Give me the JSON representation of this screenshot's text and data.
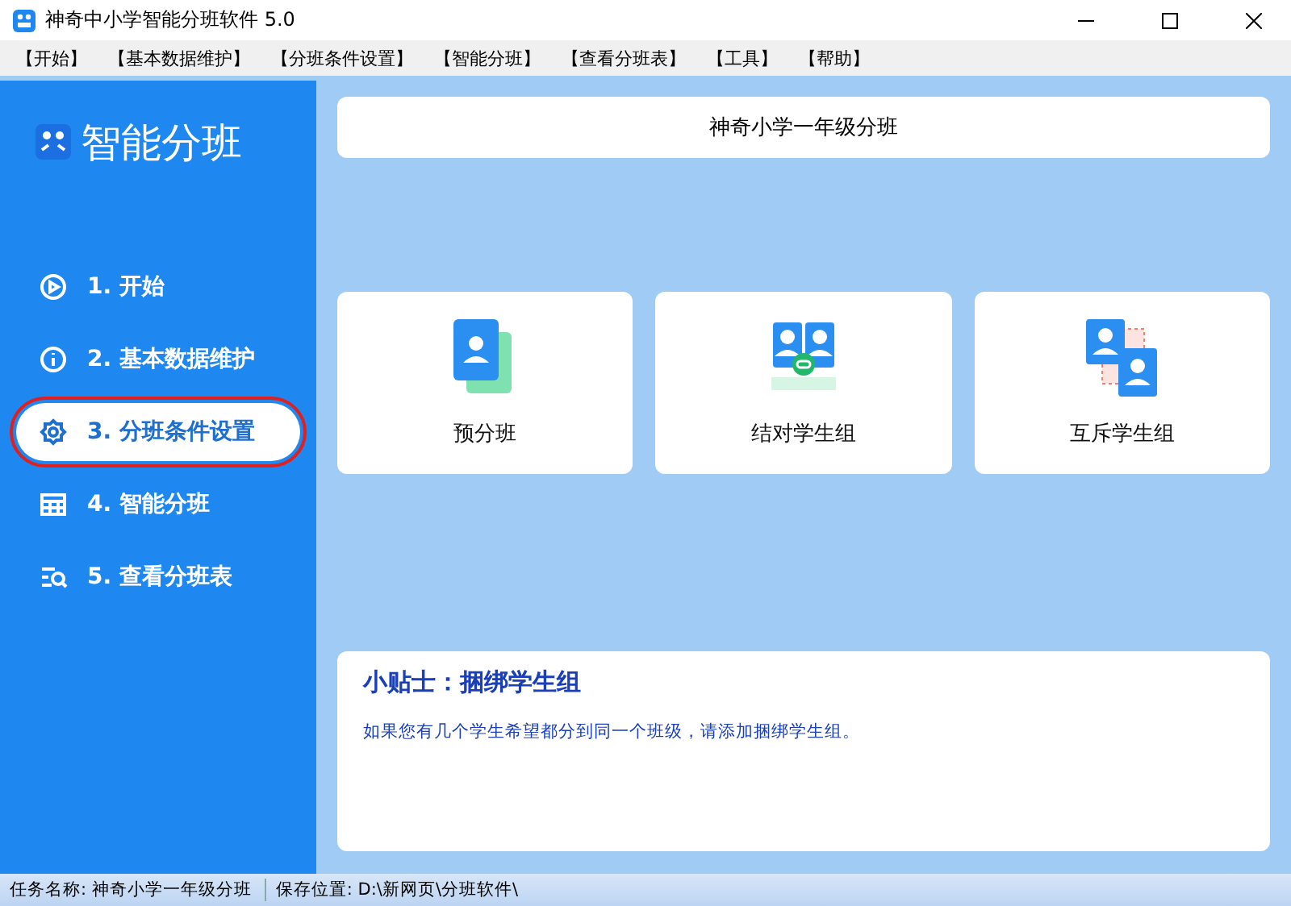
{
  "window": {
    "title": "神奇中小学智能分班软件 5.0"
  },
  "menu": [
    "【开始】",
    "【基本数据维护】",
    "【分班条件设置】",
    "【智能分班】",
    "【查看分班表】",
    "【工具】",
    "【帮助】"
  ],
  "sidebar": {
    "logo": "智能分班",
    "items": [
      {
        "label": "1. 开始",
        "selected": false
      },
      {
        "label": "2. 基本数据维护",
        "selected": false
      },
      {
        "label": "3. 分班条件设置",
        "selected": true
      },
      {
        "label": "4. 智能分班",
        "selected": false
      },
      {
        "label": "5. 查看分班表",
        "selected": false
      }
    ]
  },
  "header": "神奇小学一年级分班",
  "cards": [
    {
      "label": "预分班",
      "kind": "pre"
    },
    {
      "label": "结对学生组",
      "kind": "pair"
    },
    {
      "label": "互斥学生组",
      "kind": "exclusive"
    }
  ],
  "tip": {
    "title": "小贴士：捆绑学生组",
    "text": "如果您有几个学生希望都分到同一个班级，请添加捆绑学生组。"
  },
  "status_bar": [
    {
      "label": "任务名称:",
      "value": "神奇小学一年级分班"
    },
    {
      "label": "保存位置:",
      "value": "D:\\新网页\\分班软件\\"
    }
  ]
}
